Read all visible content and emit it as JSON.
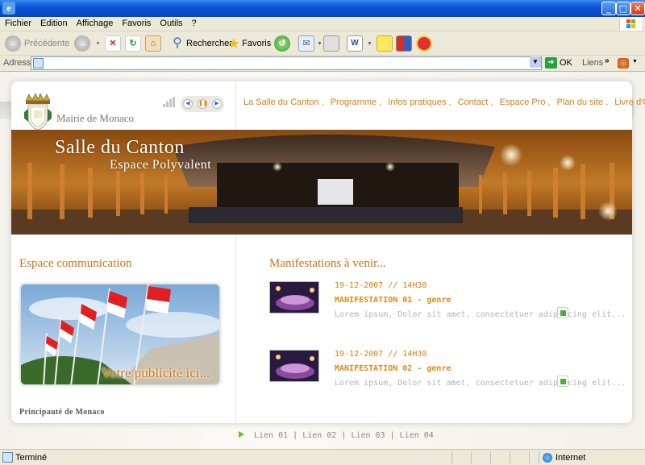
{
  "browser": {
    "title_glyph": "e",
    "menu": [
      "Fichier",
      "Edition",
      "Affichage",
      "Favoris",
      "Outils",
      "?"
    ],
    "toolbar": {
      "back": "Précédente",
      "search": "Rechercher",
      "favorites": "Favoris"
    },
    "address": {
      "label": "Adresse",
      "value": "",
      "go": "OK",
      "links": "Liens"
    },
    "status": {
      "text": "Terminé",
      "zone": "Internet"
    }
  },
  "site": {
    "mairie": "Mairie de Monaco",
    "nav": [
      "La Salle du Canton",
      "Programme",
      "Infos pratiques",
      "Contact",
      "Espace Pro",
      "Plan du site",
      "Livre d'Or"
    ],
    "banner_title": "Salle du Canton",
    "banner_subtitle": "Espace Polyvalent",
    "left_heading": "Espace communication",
    "pub_text": "Votre publicité ici...",
    "principaute": "Principauté de Monaco",
    "right_heading": "Manifestations à venir...",
    "events": [
      {
        "date": "19-12-2007 // 14H30",
        "title": "MANIFESTATION 01 - genre",
        "desc": "Lorem ipsum, Dolor sit amet, consectetuer adipiscing elit..."
      },
      {
        "date": "19-12-2007 // 14H30",
        "title": "MANIFESTATION 02 - genre",
        "desc": "Lorem ipsum, Dolor sit amet, consectetuer adipiscing elit..."
      }
    ],
    "footer_links": [
      "Lien 01",
      "Lien 02",
      "Lien 03",
      "Lien 04"
    ]
  },
  "colors": {
    "accent": "#d6800e",
    "heading": "#c3741c",
    "xp_blue": "#0a55d8"
  }
}
